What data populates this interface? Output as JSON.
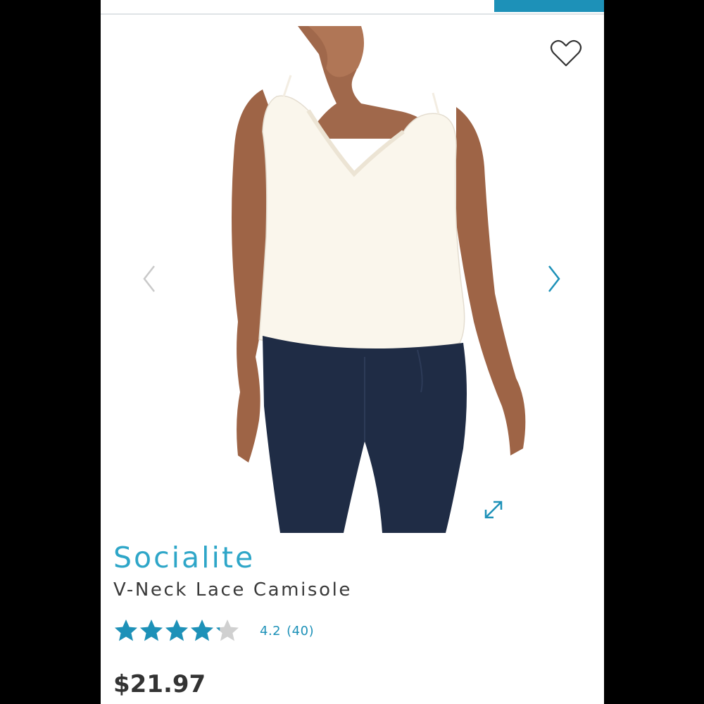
{
  "product": {
    "brand": "Socialite",
    "name": "V-Neck Lace Camisole",
    "rating_value": "4.2",
    "rating_count": "(40)",
    "rating_fraction": 0.84,
    "price": "$21.97"
  },
  "gallery": {
    "prev_icon": "chevron-left-icon",
    "next_icon": "chevron-right-icon",
    "wishlist_icon": "heart-outline-icon",
    "expand_icon": "expand-arrows-icon"
  },
  "colors": {
    "accent": "#1d91b8",
    "brand_text": "#2ea6c8",
    "star_filled": "#1d91b8",
    "star_empty": "#d0d0d0"
  }
}
